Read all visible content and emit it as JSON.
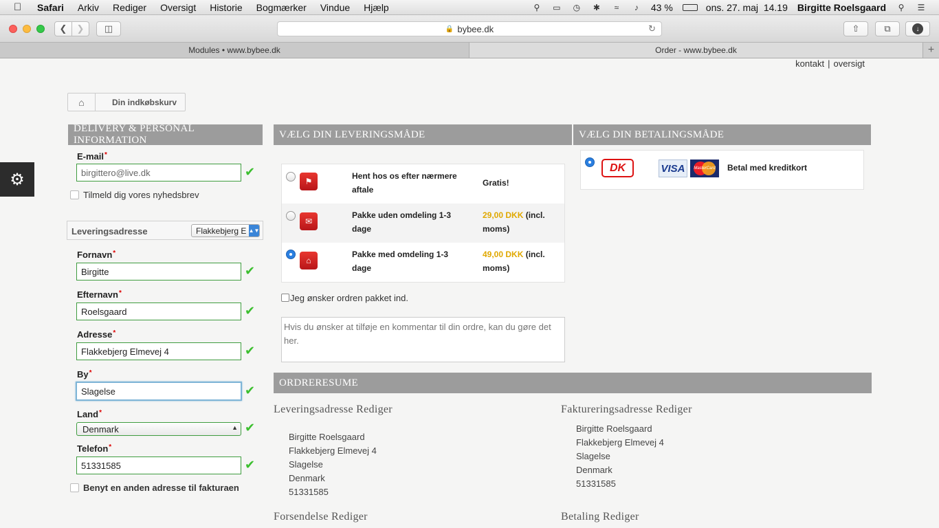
{
  "menubar": {
    "app": "Safari",
    "items": [
      "Arkiv",
      "Rediger",
      "Oversigt",
      "Historie",
      "Bogmærker",
      "Vindue",
      "Hjælp"
    ],
    "battery": "43 %",
    "datetime": "ons. 27. maj  14.19",
    "user": "Birgitte Roelsgaard"
  },
  "toolbar": {
    "url": "bybee.dk"
  },
  "tabs": [
    {
      "label": "Modules • www.bybee.dk"
    },
    {
      "label": "Order - www.bybee.dk"
    }
  ],
  "toplinks": {
    "contact": "kontakt",
    "sep": "|",
    "overview": "oversigt"
  },
  "breadcrumb": {
    "current": "Din indkøbskurv"
  },
  "delivery_info": {
    "header": "DELIVERY & PERSONAL INFORMATION",
    "email_label": "E-mail",
    "email_value": "birgittero@live.dk",
    "newsletter_label": "Tilmeld dig vores nyhedsbrev",
    "address_label": "Leveringsadresse",
    "address_select": "Flakkebjerg E",
    "firstname_label": "Fornavn",
    "firstname_value": "Birgitte",
    "lastname_label": "Efternavn",
    "lastname_value": "Roelsgaard",
    "address_field_label": "Adresse",
    "address_value": "Flakkebjerg Elmevej 4",
    "city_label": "By",
    "city_value": "Slagelse",
    "country_label": "Land",
    "country_value": "Denmark",
    "phone_label": "Telefon",
    "phone_value": "51331585",
    "other_billing_label": "Benyt en anden adresse til fakturaen",
    "required_mark": "*"
  },
  "shipping": {
    "header": "VÆLG DIN LEVERINGSMÅDE",
    "options": [
      {
        "name": "Hent hos os efter nærmere aftale",
        "price": "Gratis!",
        "price_suffix": "",
        "selected": false
      },
      {
        "name": "Pakke uden omdeling 1-3 dage",
        "price": "29,00 DKK",
        "price_suffix": " (incl. moms)",
        "selected": false
      },
      {
        "name": "Pakke med omdeling 1-3 dage",
        "price": "49,00 DKK",
        "price_suffix": " (incl. moms)",
        "selected": true
      }
    ],
    "gift_wrap_label": "Jeg ønsker ordren pakket ind.",
    "comment_placeholder": "Hvis du ønsker at tilføje en kommentar til din ordre, kan du gøre det her."
  },
  "payment": {
    "header": "VÆLG DIN BETALINGSMÅDE",
    "dk_logo": "DK",
    "visa_logo": "VISA",
    "mc_logo": "MasterCard",
    "method_label": "Betal med kreditkort"
  },
  "summary": {
    "header": "ORDRERESUME",
    "delivery_title": "Leveringsadresse Rediger",
    "delivery_lines": [
      "Birgitte Roelsgaard",
      "Flakkebjerg Elmevej 4",
      "Slagelse",
      "Denmark",
      "51331585"
    ],
    "billing_title": "Faktureringsadresse Rediger",
    "billing_lines": [
      "Birgitte Roelsgaard",
      "Flakkebjerg Elmevej 4",
      "Slagelse",
      "Denmark",
      "51331585"
    ],
    "shipping_title": "Forsendelse Rediger",
    "payment_title": "Betaling Rediger"
  },
  "colors": {
    "accent_green": "#3cbf2f",
    "header_gray": "#9c9c9c",
    "price_gold": "#e0a800",
    "radio_blue": "#2a7fe0"
  }
}
